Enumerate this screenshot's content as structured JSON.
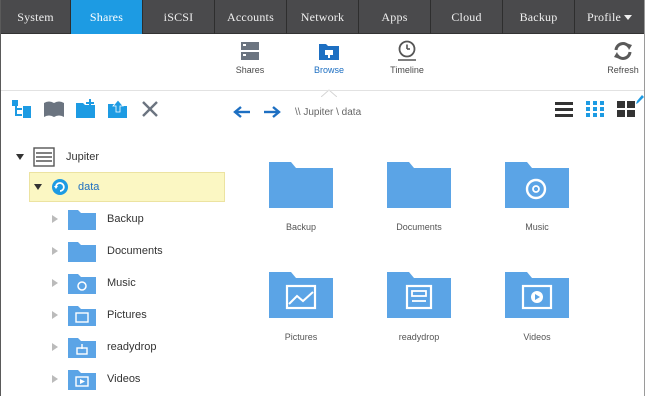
{
  "nav": {
    "tabs": [
      {
        "label": "System",
        "active": false
      },
      {
        "label": "Shares",
        "active": true
      },
      {
        "label": "iSCSI",
        "active": false
      },
      {
        "label": "Accounts",
        "active": false
      },
      {
        "label": "Network",
        "active": false
      },
      {
        "label": "Apps",
        "active": false
      },
      {
        "label": "Cloud",
        "active": false
      },
      {
        "label": "Backup",
        "active": false
      },
      {
        "label": "Profile",
        "active": false
      }
    ]
  },
  "subtabs": {
    "shares": "Shares",
    "browse": "Browse",
    "timeline": "Timeline",
    "refresh": "Refresh"
  },
  "path": "\\\\ Jupiter \\ data",
  "tree": {
    "root": "Jupiter",
    "selected": "data",
    "children": [
      "Backup",
      "Documents",
      "Music",
      "Pictures",
      "readydrop",
      "Videos"
    ]
  },
  "grid": {
    "items": [
      {
        "name": "Backup",
        "icon": "folder-icon"
      },
      {
        "name": "Documents",
        "icon": "folder-icon"
      },
      {
        "name": "Music",
        "icon": "music-folder-icon"
      },
      {
        "name": "Pictures",
        "icon": "pictures-folder-icon"
      },
      {
        "name": "readydrop",
        "icon": "readydrop-folder-icon"
      },
      {
        "name": "Videos",
        "icon": "videos-folder-icon"
      }
    ]
  },
  "colors": {
    "accent": "#1d9be3",
    "folder": "#5ba4e6",
    "nav_bg": "#4a4a4c",
    "selection": "#fbf7c3"
  }
}
